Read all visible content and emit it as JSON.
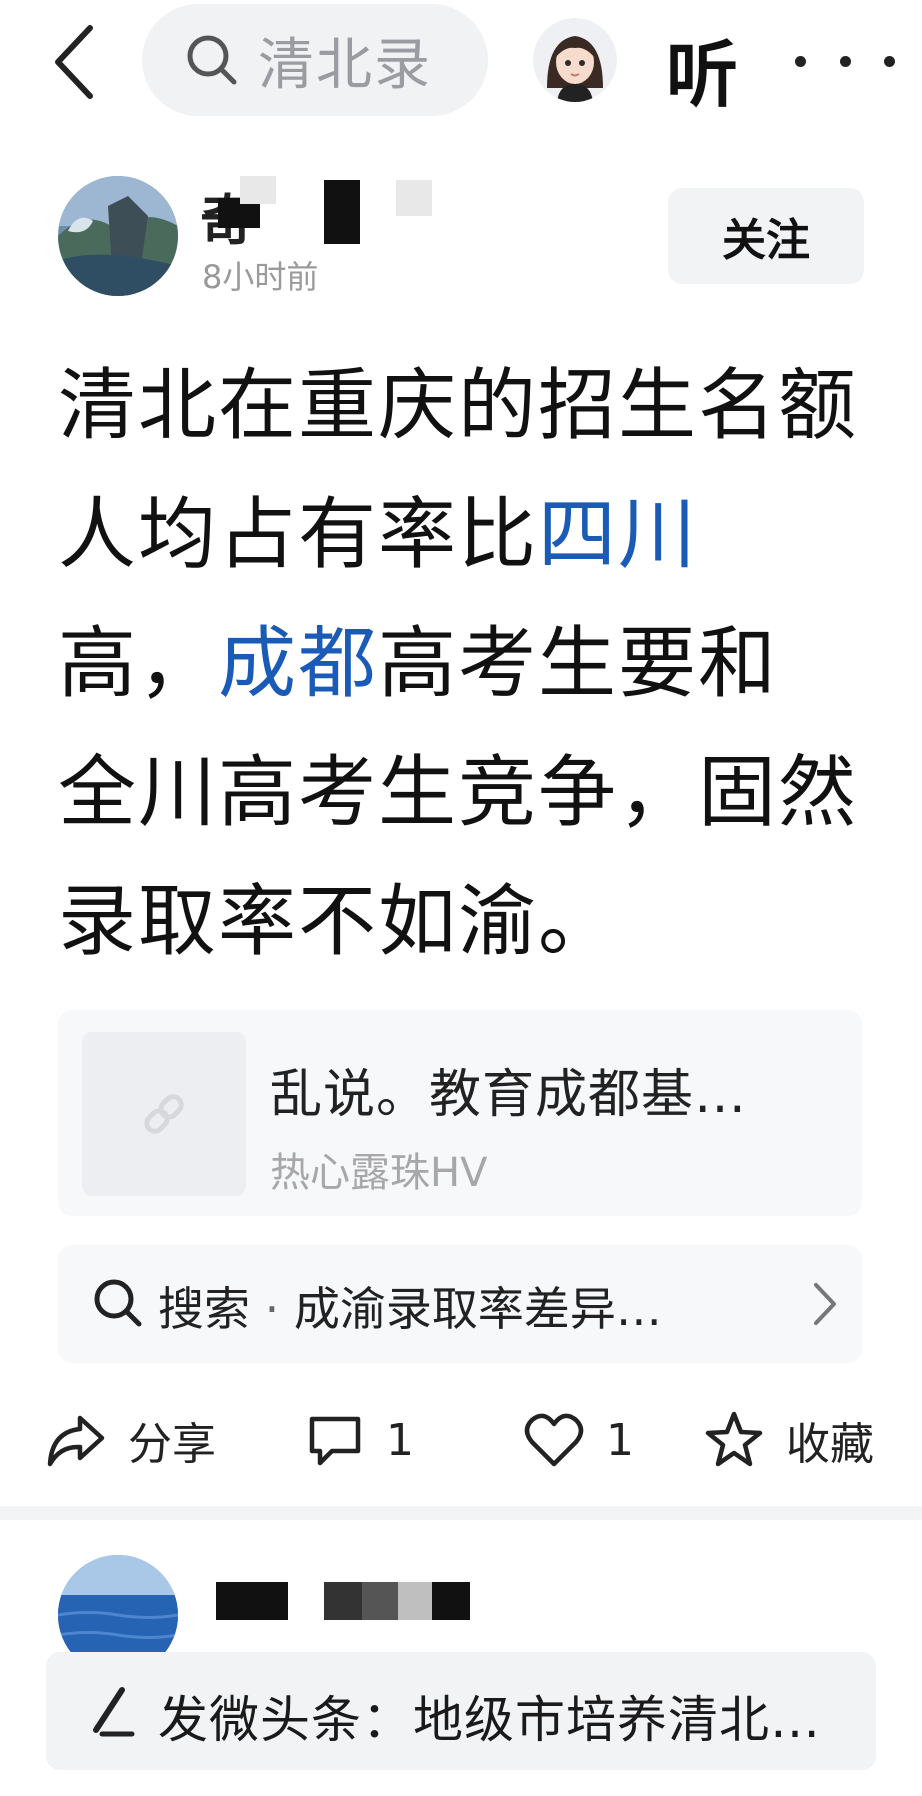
{
  "header": {
    "search_text": "清北录",
    "listen_label": "听"
  },
  "author": {
    "name_visible_glyph": "奇",
    "time": "8小时前",
    "follow_label": "关注"
  },
  "post": {
    "segments": [
      {
        "text": "清北在重庆的招生名额人均占有率比",
        "link": false
      },
      {
        "text": "四川",
        "link": true
      },
      {
        "text": "高，",
        "link": false
      },
      {
        "text": "成都",
        "link": true
      },
      {
        "text": "高考生要和全川高考生竞争，固然录取率不如渝。",
        "link": false
      }
    ]
  },
  "quoted_link": {
    "title": "乱说。教育成都基…",
    "source": "热心露珠HV"
  },
  "search_suggestion": {
    "prefix": "搜索",
    "separator": "·",
    "query": "成渝录取率差异…"
  },
  "actions": {
    "share_label": "分享",
    "comment_count": "1",
    "like_count": "1",
    "favorite_label": "收藏"
  },
  "compose": {
    "text": "发微头条：地级市培养清北…"
  },
  "colors": {
    "link": "#1a5bb8",
    "background": "#ffffff",
    "card": "#f7f8fa"
  }
}
